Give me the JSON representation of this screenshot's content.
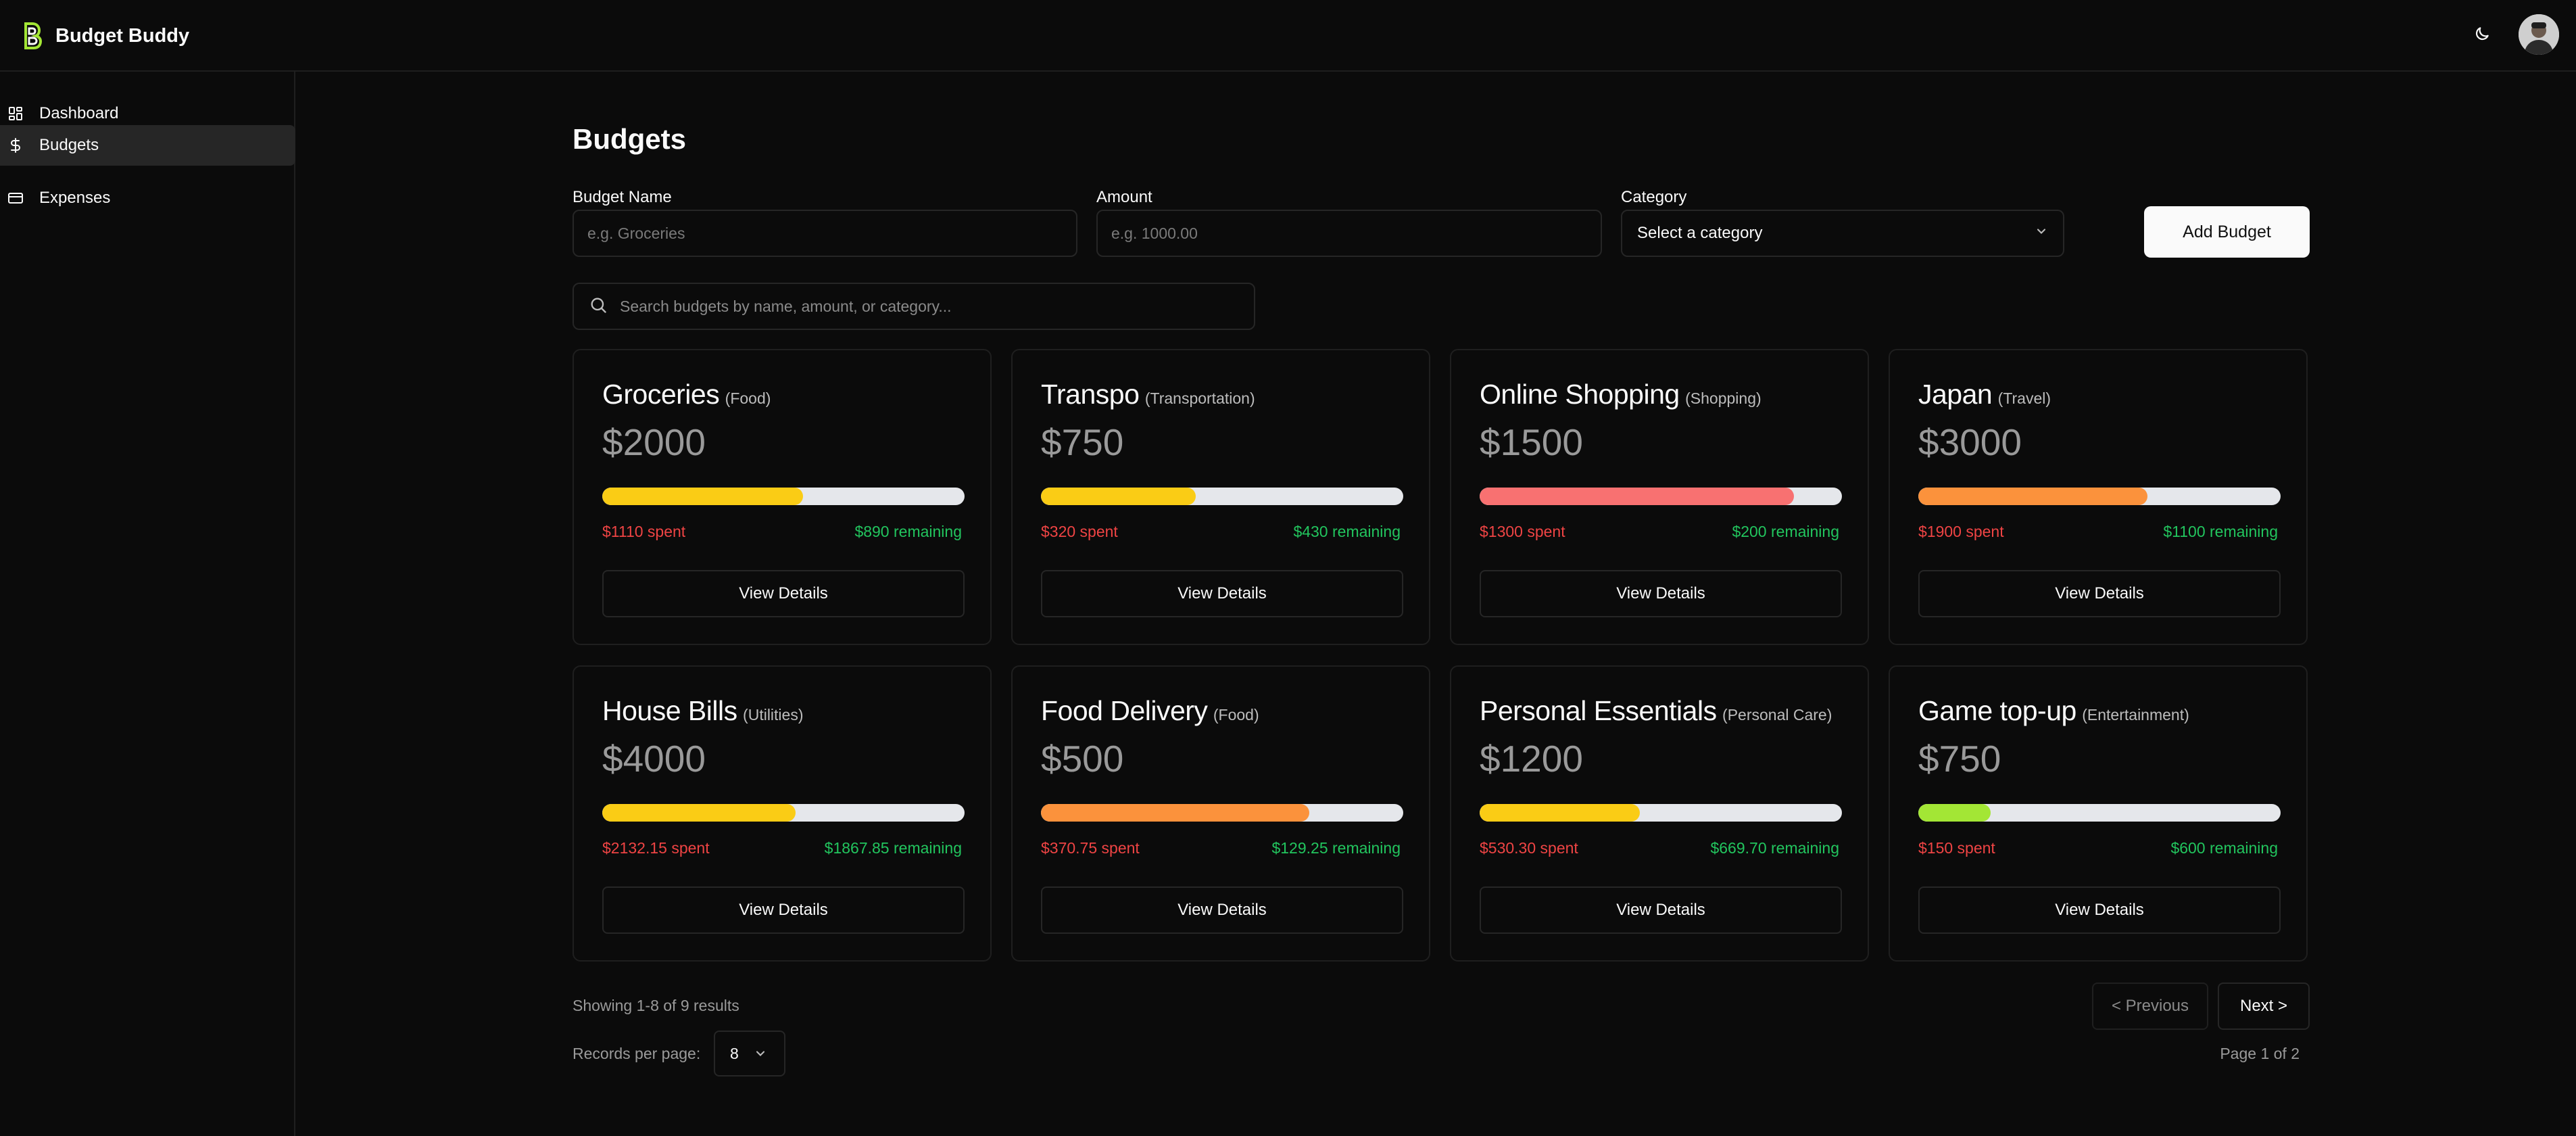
{
  "app": {
    "name": "Budget Buddy"
  },
  "sidebar": {
    "items": [
      {
        "label": "Dashboard",
        "icon": "dashboard-grid-icon",
        "active": false
      },
      {
        "label": "Budgets",
        "icon": "dollar-icon",
        "active": true
      },
      {
        "label": "Expenses",
        "icon": "credit-card-icon",
        "active": false
      }
    ]
  },
  "page": {
    "title": "Budgets"
  },
  "form": {
    "budget_name_label": "Budget Name",
    "budget_name_placeholder": "e.g. Groceries",
    "amount_label": "Amount",
    "amount_placeholder": "e.g. 1000.00",
    "category_label": "Category",
    "category_value": "Select a category",
    "add_button": "Add Budget"
  },
  "search": {
    "placeholder": "Search budgets by name, amount, or category..."
  },
  "colors": {
    "yellow": "#facc15",
    "red": "#f87171",
    "orange": "#fb923c",
    "lime": "#a3e635",
    "spent": "#ef4444",
    "remaining": "#22c55e"
  },
  "budgets": [
    {
      "name": "Groceries",
      "category": "(Food)",
      "amount": "$2000",
      "spent": "$1110 spent",
      "remaining": "$890 remaining",
      "progress": 0.555,
      "color": "#facc15",
      "button": "View Details"
    },
    {
      "name": "Transpo",
      "category": "(Transportation)",
      "amount": "$750",
      "spent": "$320 spent",
      "remaining": "$430 remaining",
      "progress": 0.427,
      "color": "#facc15",
      "button": "View Details"
    },
    {
      "name": "Online Shopping",
      "category": "(Shopping)",
      "amount": "$1500",
      "spent": "$1300 spent",
      "remaining": "$200 remaining",
      "progress": 0.867,
      "color": "#f87171",
      "button": "View Details"
    },
    {
      "name": "Japan",
      "category": "(Travel)",
      "amount": "$3000",
      "spent": "$1900 spent",
      "remaining": "$1100 remaining",
      "progress": 0.633,
      "color": "#fb923c",
      "button": "View Details"
    },
    {
      "name": "House Bills",
      "category": "(Utilities)",
      "amount": "$4000",
      "spent": "$2132.15 spent",
      "remaining": "$1867.85 remaining",
      "progress": 0.533,
      "color": "#facc15",
      "button": "View Details"
    },
    {
      "name": "Food Delivery",
      "category": "(Food)",
      "amount": "$500",
      "spent": "$370.75 spent",
      "remaining": "$129.25 remaining",
      "progress": 0.7415,
      "color": "#fb923c",
      "button": "View Details"
    },
    {
      "name": "Personal Essentials",
      "category": "(Personal Care)",
      "amount": "$1200",
      "spent": "$530.30 spent",
      "remaining": "$669.70 remaining",
      "progress": 0.442,
      "color": "#facc15",
      "button": "View Details"
    },
    {
      "name": "Game top-up",
      "category": "(Entertainment)",
      "amount": "$750",
      "spent": "$150 spent",
      "remaining": "$600 remaining",
      "progress": 0.2,
      "color": "#a3e635",
      "button": "View Details"
    }
  ],
  "pagination": {
    "showing": "Showing 1-8 of 9 results",
    "records_label": "Records per page:",
    "records_value": "8",
    "previous": "< Previous",
    "next": "Next >",
    "page_info": "Page 1 of 2"
  }
}
